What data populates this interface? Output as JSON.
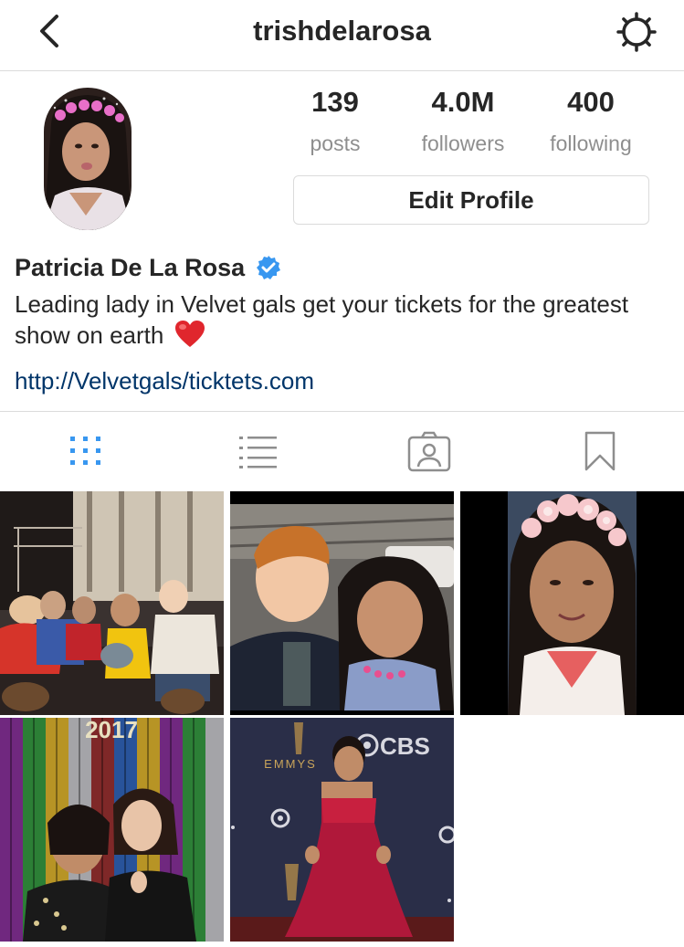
{
  "header": {
    "username": "trishdelarosa",
    "back_icon": "chevron-left-icon",
    "settings_icon": "gear-icon"
  },
  "profile": {
    "stats": [
      {
        "value": "139",
        "label": "posts"
      },
      {
        "value": "4.0M",
        "label": "followers"
      },
      {
        "value": "400",
        "label": "following"
      }
    ],
    "edit_profile_label": "Edit Profile",
    "full_name": "Patricia De La Rosa",
    "verified": true,
    "bio": "Leading lady in Velvet gals get your tickets for the greatest show on earth",
    "bio_emoji": "red-heart",
    "link": "http://Velvetgals/ticktets.com"
  },
  "tabs": [
    {
      "icon": "grid-icon",
      "active": true
    },
    {
      "icon": "list-icon",
      "active": false
    },
    {
      "icon": "tagged-photos-icon",
      "active": false
    },
    {
      "icon": "bookmark-icon",
      "active": false
    }
  ],
  "posts": {
    "count_visible": 5,
    "emmy_sign_text": "EMMYS",
    "cbs_sign_text": "CBS",
    "party_sign_text": "2017"
  },
  "colors": {
    "accent_blue": "#3897f0",
    "link_blue": "#003569",
    "text": "#262626",
    "muted": "#8e8e8e",
    "border": "#dbdbdb"
  }
}
